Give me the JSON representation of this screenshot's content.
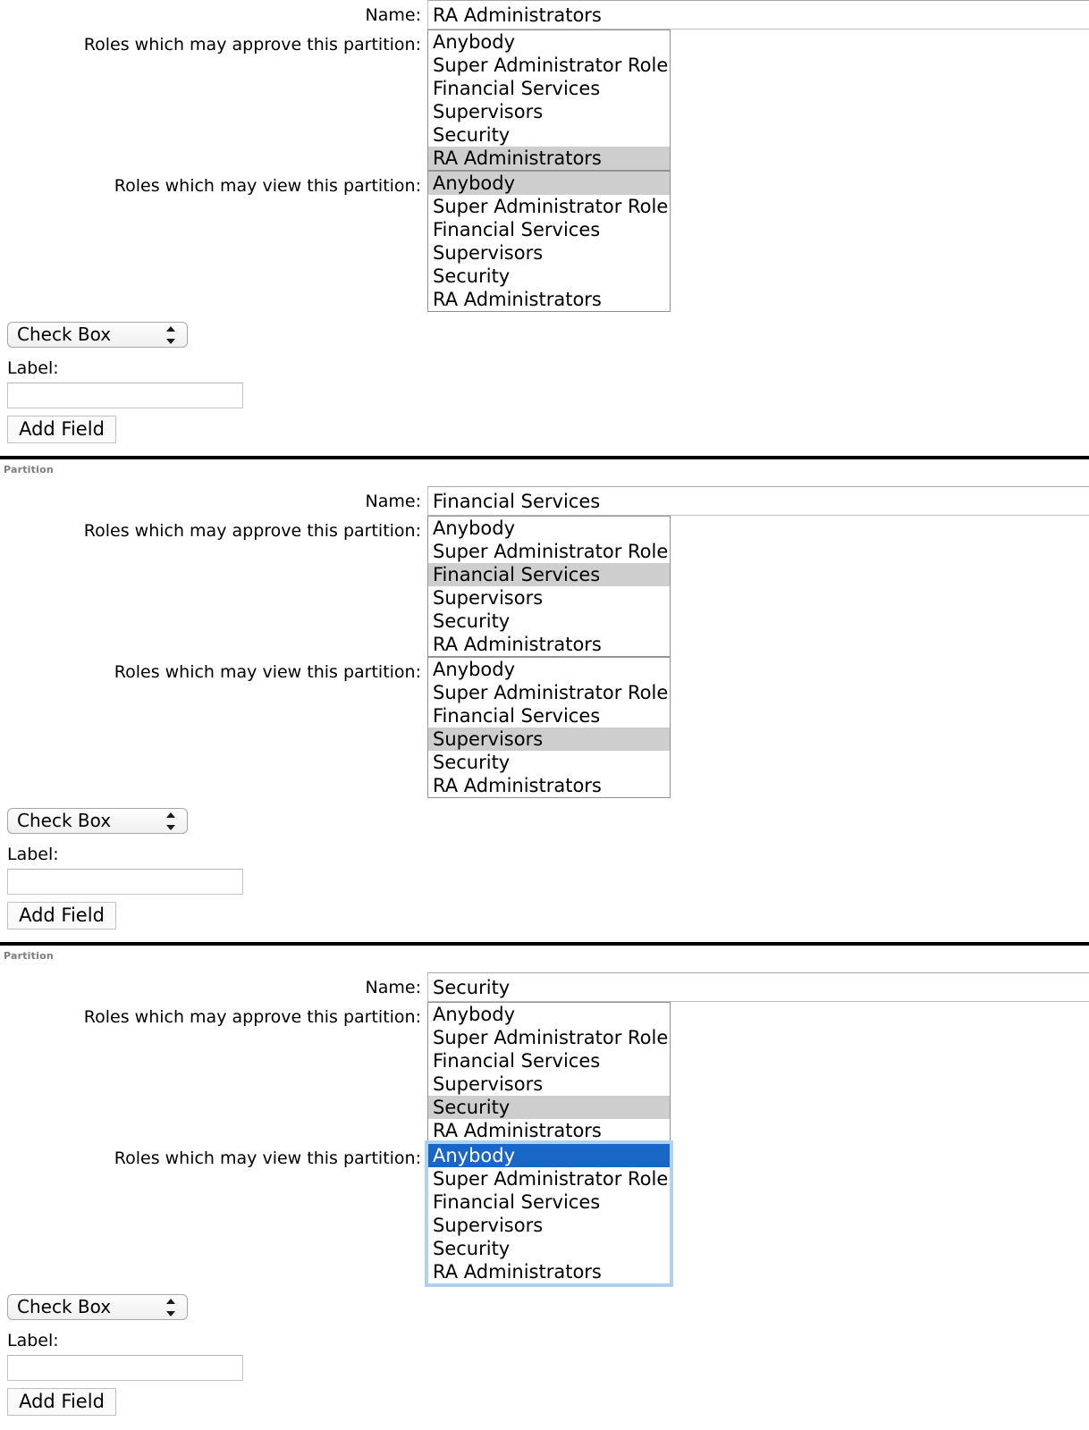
{
  "common": {
    "name_label": "Name:",
    "approve_label": "Roles which may approve this partition:",
    "view_label": "Roles which may view this partition:",
    "legend": "Partition",
    "field_type_value": "Check Box",
    "field_label_caption": "Label:",
    "field_label_value": "",
    "field_label_placeholder": "",
    "add_field_label": "Add Field",
    "roles": [
      "Anybody",
      "Super Administrator Role",
      "Financial Services",
      "Supervisors",
      "Security",
      "RA Administrators"
    ]
  },
  "colors": {
    "selected_bg": "#cecece",
    "focus_selected_bg": "#1866c8",
    "focus_ring": "#aed2f3",
    "legend_text": "#7d7d7d",
    "separator": "#000000"
  },
  "partitions": [
    {
      "name_value": "RA Administrators",
      "approve_options": [
        {
          "label": "Anybody",
          "selected": false
        },
        {
          "label": "Super Administrator Role",
          "selected": false
        },
        {
          "label": "Financial Services",
          "selected": false
        },
        {
          "label": "Supervisors",
          "selected": false
        },
        {
          "label": "Security",
          "selected": false
        },
        {
          "label": "RA Administrators",
          "selected": true
        }
      ],
      "view_options": [
        {
          "label": "Anybody",
          "selected": true
        },
        {
          "label": "Super Administrator Role",
          "selected": false
        },
        {
          "label": "Financial Services",
          "selected": false
        },
        {
          "label": "Supervisors",
          "selected": false
        },
        {
          "label": "Security",
          "selected": false
        },
        {
          "label": "RA Administrators",
          "selected": false
        }
      ],
      "view_focused": false,
      "show_legend": false
    },
    {
      "name_value": "Financial Services",
      "approve_options": [
        {
          "label": "Anybody",
          "selected": false
        },
        {
          "label": "Super Administrator Role",
          "selected": false
        },
        {
          "label": "Financial Services",
          "selected": true
        },
        {
          "label": "Supervisors",
          "selected": false
        },
        {
          "label": "Security",
          "selected": false
        },
        {
          "label": "RA Administrators",
          "selected": false
        }
      ],
      "view_options": [
        {
          "label": "Anybody",
          "selected": false
        },
        {
          "label": "Super Administrator Role",
          "selected": false
        },
        {
          "label": "Financial Services",
          "selected": false
        },
        {
          "label": "Supervisors",
          "selected": true
        },
        {
          "label": "Security",
          "selected": false
        },
        {
          "label": "RA Administrators",
          "selected": false
        }
      ],
      "view_focused": false,
      "show_legend": true
    },
    {
      "name_value": "Security",
      "approve_options": [
        {
          "label": "Anybody",
          "selected": false
        },
        {
          "label": "Super Administrator Role",
          "selected": false
        },
        {
          "label": "Financial Services",
          "selected": false
        },
        {
          "label": "Supervisors",
          "selected": false
        },
        {
          "label": "Security",
          "selected": true
        },
        {
          "label": "RA Administrators",
          "selected": false
        }
      ],
      "view_options": [
        {
          "label": "Anybody",
          "selected": true
        },
        {
          "label": "Super Administrator Role",
          "selected": false
        },
        {
          "label": "Financial Services",
          "selected": false
        },
        {
          "label": "Supervisors",
          "selected": false
        },
        {
          "label": "Security",
          "selected": false
        },
        {
          "label": "RA Administrators",
          "selected": false
        }
      ],
      "view_focused": true,
      "show_legend": true
    }
  ]
}
